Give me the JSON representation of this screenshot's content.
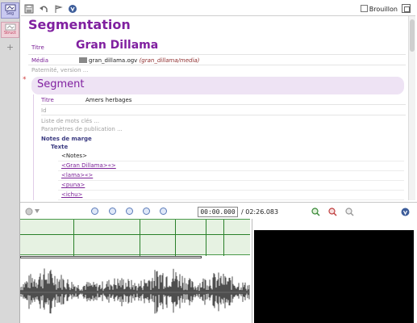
{
  "tabs": {
    "seg": "Seg",
    "struct": "Struct"
  },
  "toolbar": {
    "draft_label": "Brouillon"
  },
  "form": {
    "heading": "Segmentation",
    "title_label": "Titre",
    "title_value": "Gran Dillama",
    "media_label": "Média",
    "media_file": "gran_dillama.ogv",
    "media_path": "(gran_dillama/media)",
    "paternity_label": "Paternité, version ...",
    "segment": {
      "heading": "Segment",
      "title_label": "Titre",
      "title_value": "Amers herbages",
      "id_label": "Id",
      "keywords_label": "Liste de mots clés ...",
      "publication_label": "Paramètres de publication ...",
      "margin_notes_label": "Notes de marge",
      "text_label": "Texte",
      "notes": [
        {
          "text": "<Notes>",
          "link": false
        },
        {
          "text": "<Gran Dillama>«>",
          "link": true
        },
        {
          "text": "<lama>«>",
          "link": true
        },
        {
          "text": "<puna>",
          "link": true
        },
        {
          "text": "<ichu>",
          "link": true
        }
      ]
    }
  },
  "player": {
    "current_time": "00:00.000",
    "duration": "/ 02:26.083"
  },
  "colors": {
    "accent": "#8020a0",
    "timeline_green": "#2a802a",
    "video_bg": "#000000"
  }
}
